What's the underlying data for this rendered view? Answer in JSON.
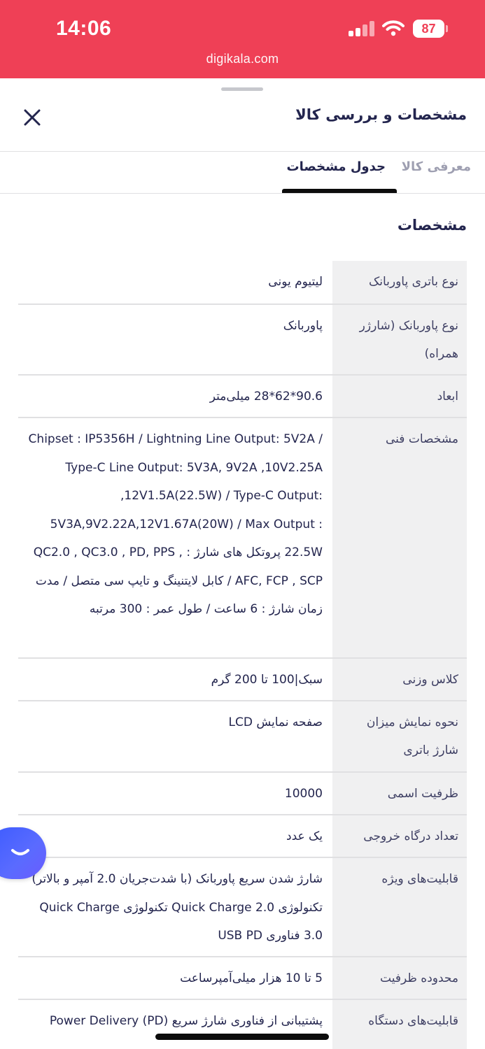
{
  "status_bar": {
    "time": "14:06",
    "url": "digikala.com",
    "battery": "87",
    "background_color": "#ef4056"
  },
  "sheet": {
    "title": "مشخصات و بررسی کالا",
    "close_icon": "close-icon"
  },
  "tabs": [
    {
      "label": "معرفی کالا",
      "active": false
    },
    {
      "label": "جدول مشخصات",
      "active": true
    }
  ],
  "section_title": "مشخصات",
  "specs": [
    {
      "key": "نوع باتری پاوربانک",
      "value": "لیتیوم یونی"
    },
    {
      "key": "نوع پاوربانک (شارژر همراه)",
      "value": "پاوربانک"
    },
    {
      "key": "ابعاد",
      "value": "90.6*62*28 میلی‌متر"
    },
    {
      "key": "مشخصات فنی",
      "value": "Chipset : IP5356H / Lightning Line Output: 5V2A / Type-C Line Output: 5V3A, 9V2A ,10V2.25A ,12V1.5A(22.5W) / Type-C Output: 5V3A,9V2.22A,12V1.67A(20W) / Max Output : 22.5W پروتکل های شارژ : QC2.0 , QC3.0 , PD, PPS , AFC, FCP , SCP / کابل لایتنینگ و تایپ سی متصل / مدت زمان شارژ : 6 ساعت / طول عمر : 300 مرتبه"
    },
    {
      "key": "کلاس وزنی",
      "value": "سبک|100 تا 200 گرم"
    },
    {
      "key": "نحوه نمایش میزان شارژ باتری",
      "value": "صفحه نمایش LCD"
    },
    {
      "key": "ظرفیت اسمی",
      "value": "10000"
    },
    {
      "key": "تعداد درگاه خروجی",
      "value": "یک عدد"
    },
    {
      "key": "قابلیت‌های ویژه",
      "value": "شارژ شدن سریع پاوربانک (با شدت‌جریان 2.0 آمپر و بالاتر) تکنولوژی Quick Charge 2.0 تکنولوژی Quick Charge 3.0 فناوری USB PD"
    },
    {
      "key": "محدوده ظرفیت",
      "value": "5 تا 10 هزار میلی‌آمپرساعت"
    },
    {
      "key": "قابلیت‌های دستگاه",
      "value": "پشتیبانی از فناوری شارژ سریع Power Delivery (PD)"
    }
  ],
  "help_button": {
    "icon": "chat-smile-icon"
  }
}
